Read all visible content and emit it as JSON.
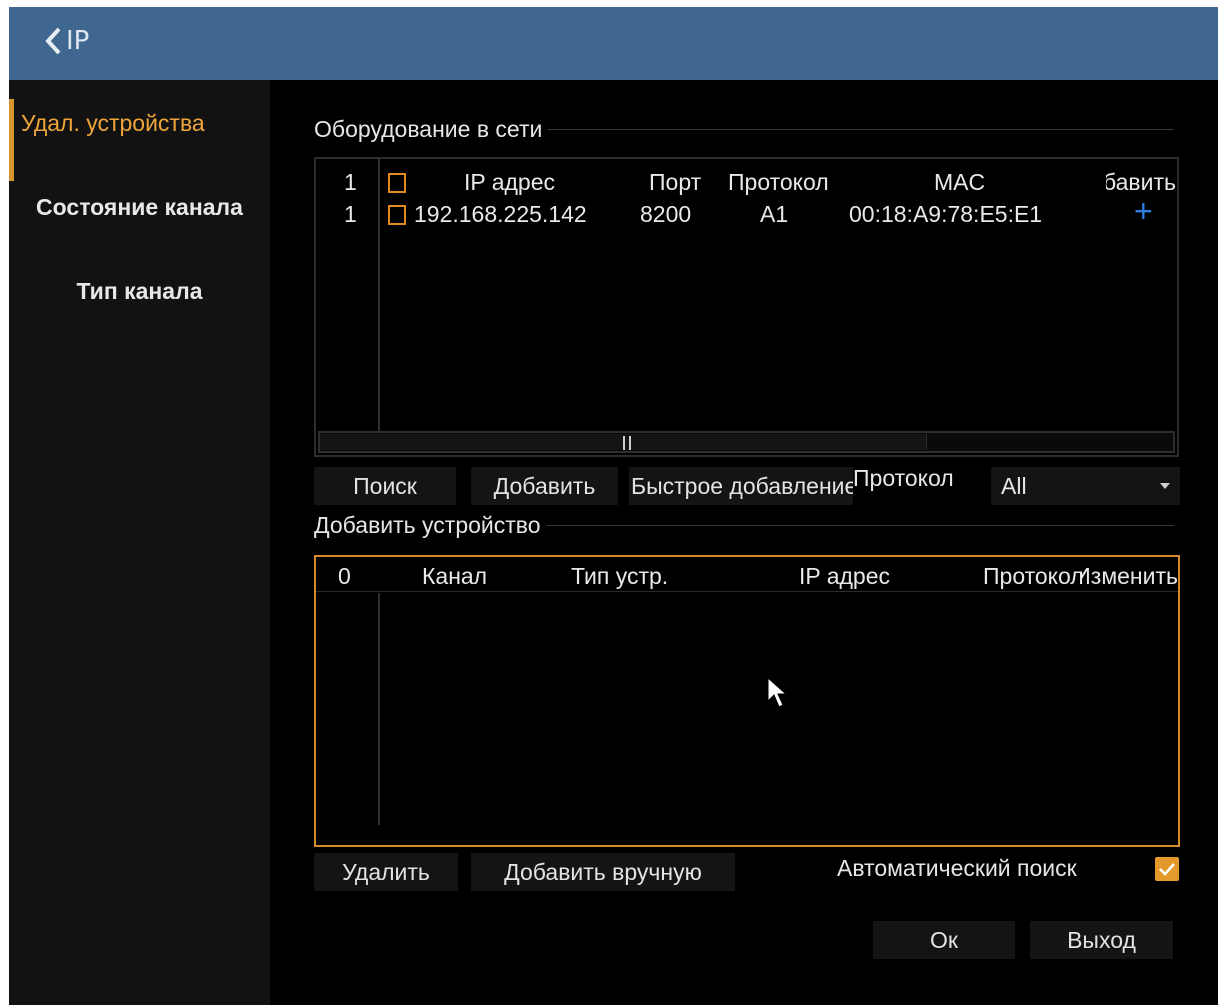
{
  "titlebar": {
    "back_label": "IP"
  },
  "sidebar": {
    "items": [
      {
        "label": "Удал. устройства",
        "active": true
      },
      {
        "label": "Состояние канала",
        "active": false
      },
      {
        "label": "Тип канала",
        "active": false
      }
    ]
  },
  "network": {
    "section_title": "Оборудование в сети",
    "header": {
      "index": "1",
      "ip": "IP адрес",
      "port": "Порт",
      "protocol": "Протокол",
      "mac": "MAC",
      "add": "Добавить"
    },
    "rows": [
      {
        "index": "1",
        "ip": "192.168.225.142",
        "port": "8200",
        "protocol": "A1",
        "mac": "00:18:A9:78:E5:E1",
        "add_icon": "plus-icon"
      }
    ]
  },
  "buttons": {
    "search": "Поиск",
    "add": "Добавить",
    "quick_add": "Быстрое добавление",
    "protocol_label": "Протокол",
    "protocol_value": "All",
    "delete": "Удалить",
    "manual_add": "Добавить вручную",
    "ok": "Ок",
    "exit": "Выход"
  },
  "added": {
    "section_title": "Добавить устройство",
    "header": {
      "index": "0",
      "channel": "Канал",
      "device_type": "Тип устр.",
      "ip": "IP адрес",
      "protocol": "Протокол",
      "change": "Изменить"
    }
  },
  "auto_search": {
    "label": "Автоматический поиск",
    "checked": true
  },
  "colors": {
    "accent": "#d58b2a",
    "titlebar": "#3f6790",
    "plus": "#2f7fe0"
  }
}
